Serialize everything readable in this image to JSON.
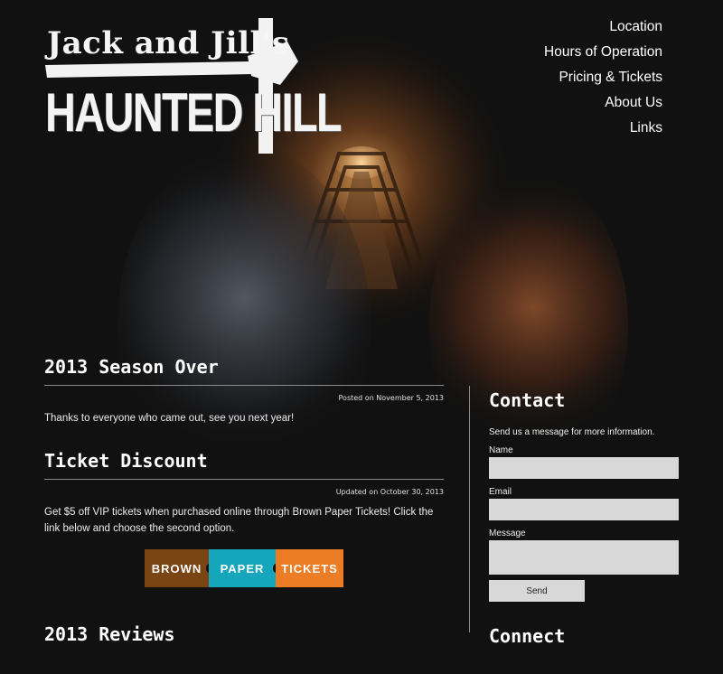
{
  "site": {
    "logo_line1": "Jack and Jill's",
    "logo_line2": "HAUNTED HILL",
    "logo_icon": "pick-axe-icon"
  },
  "nav": {
    "items": [
      {
        "label": "Location"
      },
      {
        "label": "Hours of Operation"
      },
      {
        "label": "Pricing & Tickets"
      },
      {
        "label": "About Us"
      },
      {
        "label": "Links"
      }
    ]
  },
  "posts": [
    {
      "title": "2013 Season Over",
      "meta": "Posted on November 5, 2013",
      "body": "Thanks to everyone who came out, see you next year!"
    },
    {
      "title": "Ticket Discount",
      "meta": "Updated on October 30, 2013",
      "body": "Get $5 off VIP tickets when purchased online through Brown Paper Tickets! Click the link below and choose the second option."
    },
    {
      "title": "2013 Reviews"
    }
  ],
  "ticket_banner": {
    "word1": "BROWN",
    "word2": "PAPER",
    "word3": "TICKETS",
    "colors": {
      "brown": "#7a4413",
      "paper": "#16a6bb",
      "tickets": "#ec7d24"
    }
  },
  "sidebar": {
    "contact_title": "Contact",
    "contact_intro": "Send us a message for more information.",
    "name_label": "Name",
    "email_label": "Email",
    "message_label": "Message",
    "send_label": "Send",
    "connect_title": "Connect"
  },
  "colors": {
    "background": "#111111",
    "text": "#ffffff",
    "input_bg": "#d8d8d8"
  }
}
